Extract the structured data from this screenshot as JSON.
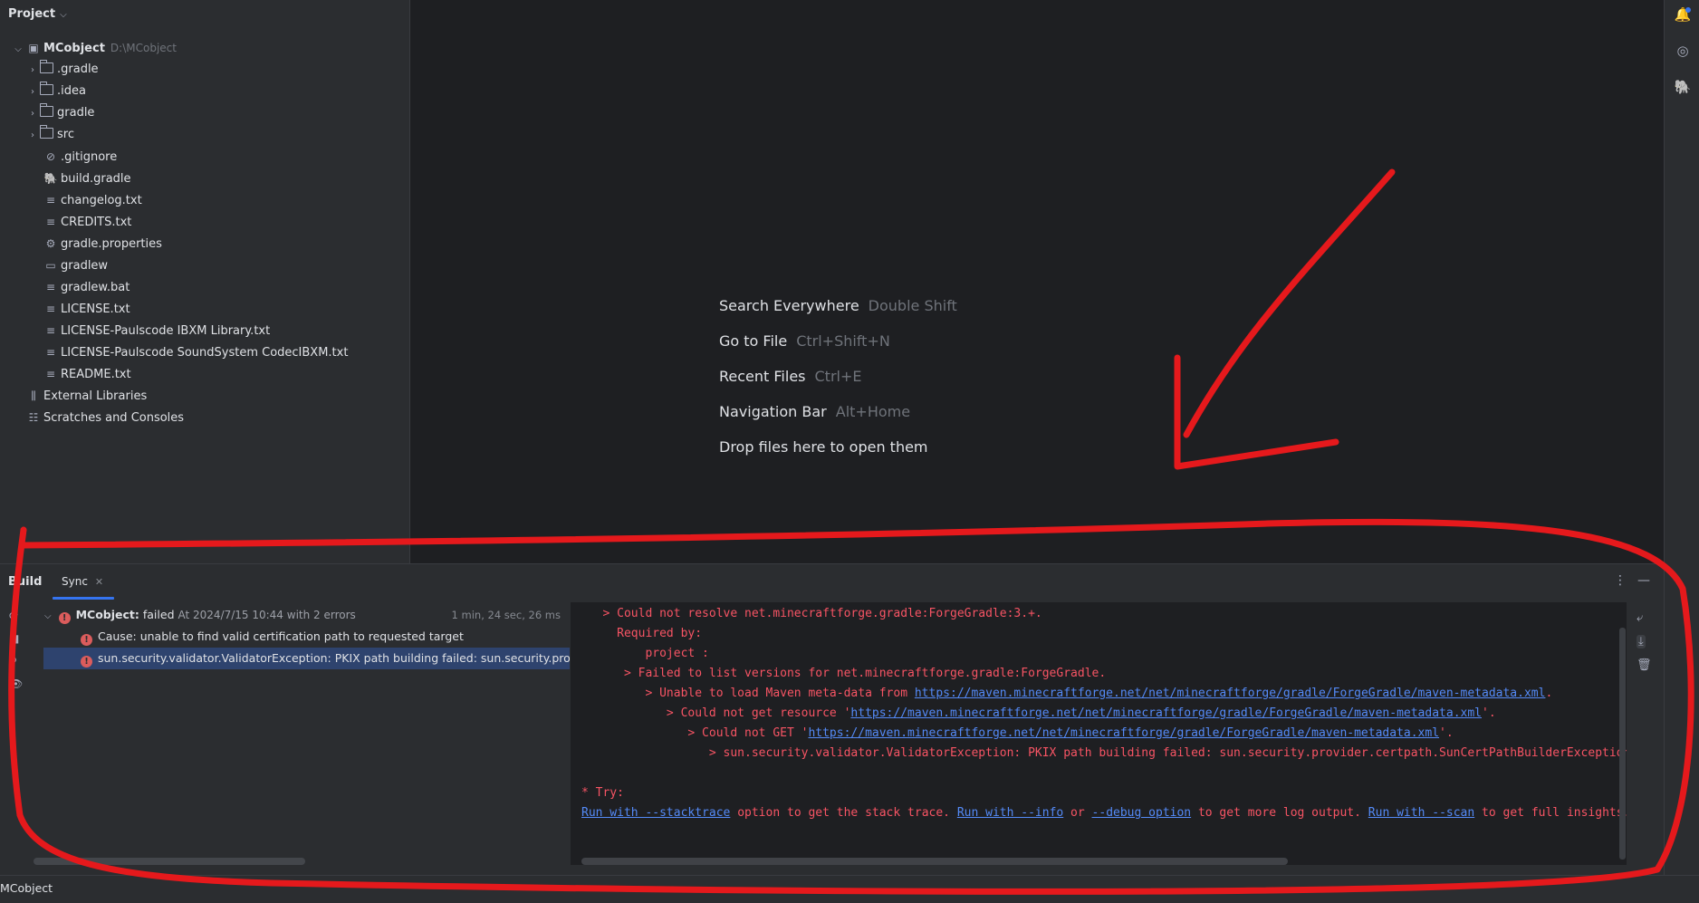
{
  "project_panel": {
    "title": "Project",
    "root": {
      "name": "MCobject",
      "path": "D:\\MCobject"
    },
    "folders": [
      ".gradle",
      ".idea",
      "gradle",
      "src"
    ],
    "files": [
      {
        "name": ".gitignore",
        "icon": "ignore-icon"
      },
      {
        "name": "build.gradle",
        "icon": "gradle-icon"
      },
      {
        "name": "changelog.txt",
        "icon": "text-file-icon"
      },
      {
        "name": "CREDITS.txt",
        "icon": "text-file-icon"
      },
      {
        "name": "gradle.properties",
        "icon": "settings-file-icon"
      },
      {
        "name": "gradlew",
        "icon": "shell-script-icon"
      },
      {
        "name": "gradlew.bat",
        "icon": "text-file-icon"
      },
      {
        "name": "LICENSE.txt",
        "icon": "text-file-icon"
      },
      {
        "name": "LICENSE-Paulscode IBXM Library.txt",
        "icon": "text-file-icon"
      },
      {
        "name": "LICENSE-Paulscode SoundSystem CodecIBXM.txt",
        "icon": "text-file-icon"
      },
      {
        "name": "README.txt",
        "icon": "text-file-icon"
      }
    ],
    "extra": [
      {
        "name": "External Libraries",
        "icon": "library-icon"
      },
      {
        "name": "Scratches and Consoles",
        "icon": "scratches-icon"
      }
    ]
  },
  "editor_hints": [
    {
      "label": "Search Everywhere",
      "keys": "Double Shift"
    },
    {
      "label": "Go to File",
      "keys": "Ctrl+Shift+N"
    },
    {
      "label": "Recent Files",
      "keys": "Ctrl+E"
    },
    {
      "label": "Navigation Bar",
      "keys": "Alt+Home"
    },
    {
      "label": "Drop files here to open them",
      "keys": ""
    }
  ],
  "build": {
    "title": "Build",
    "tab": "Sync",
    "result": {
      "name": "MCobject:",
      "status": "failed",
      "meta": "At 2024/7/15 10:44 with 2 errors",
      "duration": "1 min, 24 sec, 26 ms"
    },
    "errors": [
      "Cause: unable to find valid certification path to requested target",
      "sun.security.validator.ValidatorException: PKIX path building failed: sun.security.provider.certpath.SunCertPathBuilderException: unable to find valid certification path to requested target"
    ],
    "console": {
      "l1": "   > Could not resolve net.minecraftforge.gradle:ForgeGradle:3.+.",
      "l2": "     Required by:",
      "l3": "         project :",
      "l4": "      > Failed to list versions for net.minecraftforge.gradle:ForgeGradle.",
      "l5_pre": "         > Unable to load Maven meta-data from ",
      "l5_link": "https://maven.minecraftforge.net/net/minecraftforge/gradle/ForgeGradle/maven-metadata.xml",
      "l5_post": ".",
      "l6_pre": "            > Could not get resource '",
      "l6_link": "https://maven.minecraftforge.net/net/minecraftforge/gradle/ForgeGradle/maven-metadata.xml",
      "l6_post": "'.",
      "l7_pre": "               > Could not GET '",
      "l7_link": "https://maven.minecraftforge.net/net/minecraftforge/gradle/ForgeGradle/maven-metadata.xml",
      "l7_post": "'.",
      "l8": "                  > sun.security.validator.ValidatorException: PKIX path building failed: sun.security.provider.certpath.SunCertPathBuilderException",
      "try": "* Try:",
      "t_link1": "Run with --stacktrace",
      "t_txt1": " option to get the stack trace. ",
      "t_link2": "Run with --info",
      "t_txt2": " or ",
      "t_link3": "--debug option",
      "t_txt3": " to get more log output. ",
      "t_link4": "Run with --scan",
      "t_txt4": " to get full insights."
    }
  },
  "status_bar": {
    "text": "MCobject"
  },
  "colors": {
    "annotation": "#e5191c",
    "accent": "#3574f0",
    "error": "#db5c5c"
  }
}
